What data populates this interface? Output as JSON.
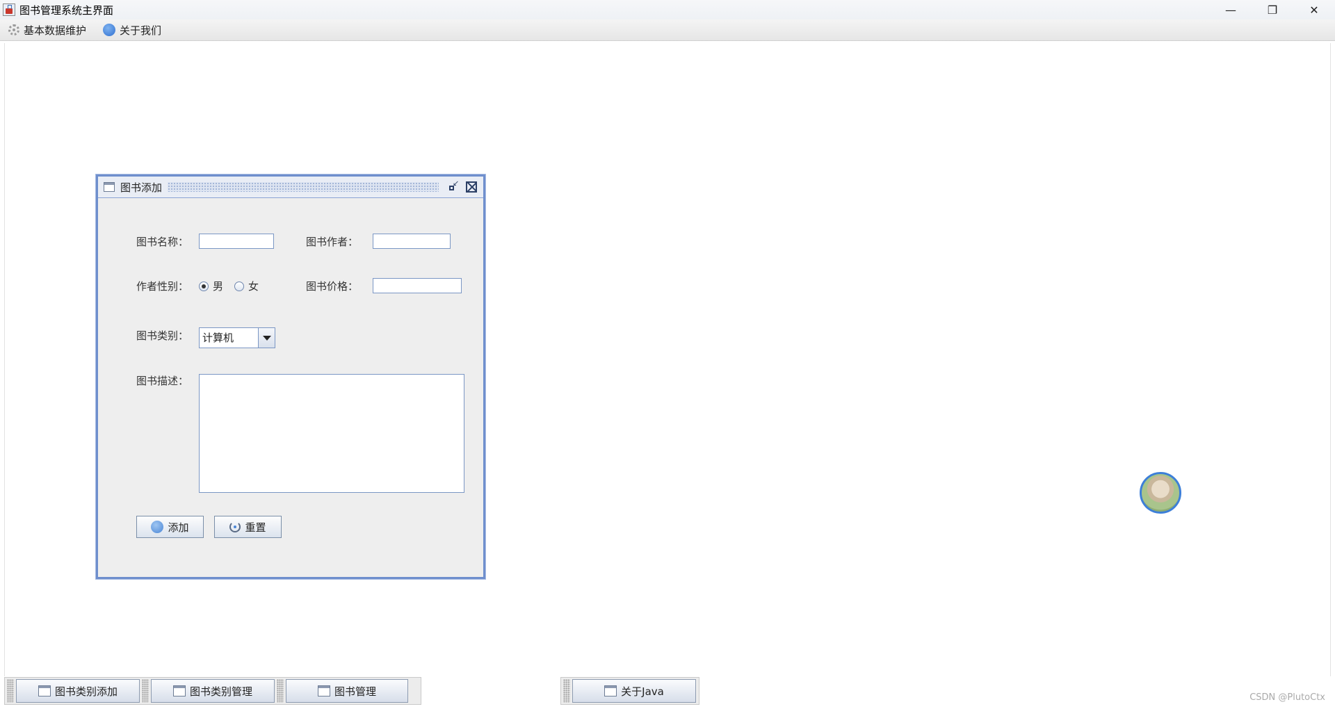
{
  "window": {
    "title": "图书管理系统主界面",
    "controls": {
      "minimize": "—",
      "maximize": "❐",
      "close": "✕"
    }
  },
  "menubar": {
    "items": [
      {
        "label": "基本数据维护",
        "icon": "gear-icon"
      },
      {
        "label": "关于我们",
        "icon": "info-icon"
      }
    ]
  },
  "internal_frame": {
    "title": "图书添加",
    "form": {
      "name_label": "图书名称：",
      "name_value": "",
      "author_label": "图书作者：",
      "author_value": "",
      "gender_label": "作者性别：",
      "gender_options": [
        "男",
        "女"
      ],
      "gender_selected": "男",
      "price_label": "图书价格：",
      "price_value": "",
      "category_label": "图书类别：",
      "category_value": "计算机",
      "desc_label": "图书描述：",
      "desc_value": "",
      "add_button": "添加",
      "reset_button": "重置"
    }
  },
  "toolbar": {
    "buttons": [
      "图书类别添加",
      "图书类别管理",
      "图书管理",
      "关于Java"
    ]
  },
  "watermark": "CSDN @PlutoCtx",
  "colors": {
    "frame_border": "#6f8fcd",
    "accent": "#3d7fd8"
  }
}
